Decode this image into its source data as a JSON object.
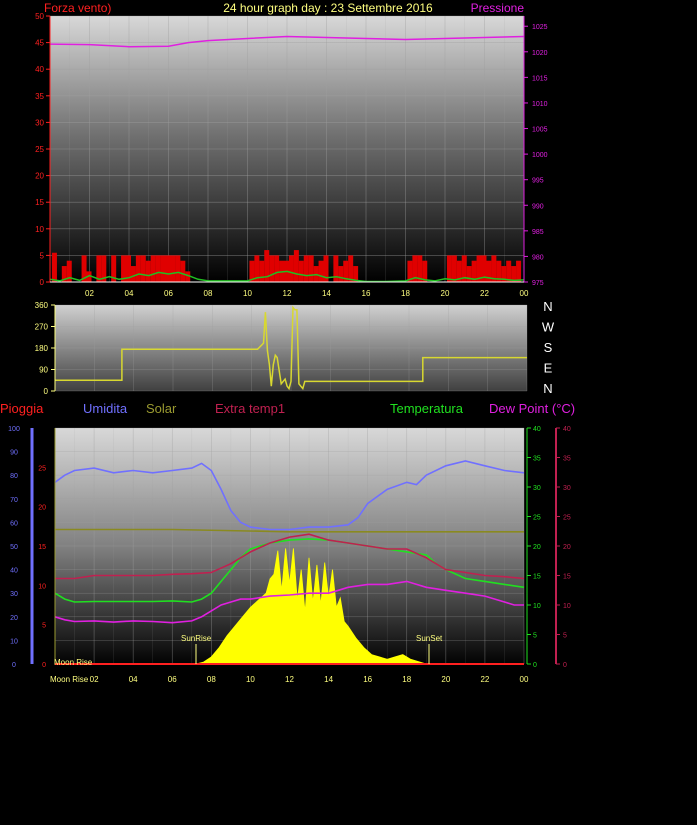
{
  "header": {
    "title": "24 hour graph day : 23 Settembre 2016",
    "left_label": "Forza vento)",
    "right_label": "Pressione"
  },
  "wind_dir_side_labels": [
    "N",
    "W",
    "S",
    "E",
    "N"
  ],
  "legend3": {
    "pioggia": "Pioggia",
    "umidita": "Umidita",
    "solar": "Solar",
    "extra_temp": "Extra temp1",
    "temperatura": "Temperatura",
    "dew_point": "Dew Point (°C)"
  },
  "event_labels": {
    "moon_rise": "Moon Rise",
    "moon_rise_axis": "Moon Rise",
    "sun_rise": "SunRise",
    "sun_set": "SunSet"
  },
  "colors": {
    "wind_axis": "#ff2020",
    "pressure": "#e020e0",
    "wind_bar": "#e00000",
    "gust": "#20c020",
    "direction": "#d8d830",
    "pioggia": "#ff2020",
    "umidita": "#7070ff",
    "solar": "#ffff00",
    "temperatura": "#20e020",
    "dew_point": "#e020e0",
    "extra_temp": "#c02050",
    "title": "#ffff80",
    "time_tick": "#ffff80"
  },
  "chart_data": [
    {
      "id": "wind_pressure",
      "type": "line",
      "title": "24 hour graph day : 23 Settembre 2016",
      "x_ticks": [
        "02",
        "04",
        "06",
        "08",
        "10",
        "12",
        "14",
        "16",
        "18",
        "20",
        "22",
        "00"
      ],
      "xlim": [
        0,
        24
      ],
      "y_left": {
        "label": "Forza vento)",
        "ylim": [
          0,
          50
        ],
        "ticks": [
          0,
          5,
          10,
          15,
          20,
          25,
          30,
          35,
          40,
          45,
          50
        ]
      },
      "y_right": {
        "label": "Pressione",
        "ylim": [
          975,
          1027
        ],
        "ticks": [
          975,
          980,
          985,
          990,
          995,
          1000,
          1005,
          1010,
          1015,
          1020,
          1025
        ]
      },
      "grid": true,
      "series": [
        {
          "name": "Pressione",
          "axis": "right",
          "x": [
            0,
            2,
            4,
            6,
            7,
            8,
            10,
            12,
            14,
            16,
            18,
            20,
            22,
            24
          ],
          "y": [
            1021.5,
            1021.4,
            1021,
            1021.1,
            1021.8,
            1022.2,
            1022.6,
            1023,
            1022.8,
            1022.6,
            1022.4,
            1022.6,
            1022.8,
            1023
          ]
        }
      ],
      "wind_bars": {
        "x": [
          0.25,
          0.5,
          0.75,
          1,
          1.25,
          1.5,
          1.75,
          2,
          2.25,
          2.5,
          2.75,
          3,
          3.25,
          3.5,
          3.75,
          4,
          4.25,
          4.5,
          4.75,
          5,
          5.25,
          5.5,
          5.75,
          6,
          6.25,
          6.5,
          6.75,
          7,
          7.25,
          7.5,
          7.75,
          8,
          8.25,
          8.5,
          8.75,
          9,
          9.25,
          9.5,
          9.75,
          10,
          10.25,
          10.5,
          10.75,
          11,
          11.25,
          11.5,
          11.75,
          12,
          12.25,
          12.5,
          12.75,
          13,
          13.25,
          13.5,
          13.75,
          14,
          14.25,
          14.5,
          14.75,
          15,
          15.25,
          15.5,
          15.75,
          16,
          16.25,
          16.5,
          16.75,
          17,
          17.25,
          17.5,
          17.75,
          18,
          18.25,
          18.5,
          18.75,
          19,
          19.25,
          19.5,
          19.75,
          20,
          20.25,
          20.5,
          20.75,
          21,
          21.25,
          21.5,
          21.75,
          22,
          22.25,
          22.5,
          22.75,
          23,
          23.25,
          23.5,
          23.75
        ],
        "y": [
          5.5,
          0,
          3,
          4,
          0,
          0,
          5,
          2,
          0,
          5,
          5,
          0,
          5,
          0,
          5,
          5,
          3,
          5,
          5,
          4,
          5,
          5,
          5,
          5,
          5,
          5,
          4,
          2,
          0,
          0,
          0,
          0,
          0,
          0,
          0,
          0,
          0,
          0,
          0,
          0,
          4,
          5,
          4,
          6,
          5,
          5,
          4,
          4,
          5,
          6,
          4,
          5,
          5,
          3,
          4,
          5,
          0,
          5,
          3,
          4,
          5,
          3,
          0,
          0,
          0,
          0,
          0,
          0,
          0,
          0,
          0,
          0,
          4,
          5,
          5,
          4,
          0,
          0,
          0,
          0,
          5,
          5,
          4,
          5,
          3,
          4,
          5,
          5,
          4,
          5,
          4,
          3,
          4,
          3,
          4
        ]
      },
      "gust_series": {
        "x": [
          0,
          0.5,
          1,
          1.5,
          2,
          2.5,
          3,
          3.5,
          4,
          4.5,
          5,
          5.5,
          6,
          6.5,
          7,
          7.5,
          8,
          9,
          10,
          10.5,
          11,
          11.5,
          12,
          12.5,
          13,
          13.5,
          14,
          14.5,
          15,
          15.5,
          16,
          17,
          18,
          18.5,
          19,
          19.5,
          20,
          20.5,
          21,
          21.5,
          22,
          22.5,
          23,
          23.5,
          24
        ],
        "y": [
          0.5,
          0.2,
          0.8,
          0.3,
          1.2,
          0.5,
          1,
          0.5,
          0.8,
          1.5,
          1.2,
          1.8,
          1.5,
          1.8,
          1.2,
          0.5,
          0.2,
          0.2,
          0.2,
          0.8,
          1,
          1.8,
          2,
          1.5,
          1.2,
          1.4,
          0.8,
          1,
          0.6,
          0.3,
          0.1,
          0.1,
          0.2,
          0.8,
          0.4,
          0.2,
          0.6,
          0.4,
          0.8,
          0.5,
          0.9,
          0.6,
          0.5,
          0.3,
          0.4
        ]
      }
    },
    {
      "id": "wind_direction",
      "type": "line",
      "ylim": [
        0,
        360
      ],
      "y_ticks": [
        0,
        90,
        180,
        270,
        360
      ],
      "xlim": [
        0,
        24
      ],
      "grid": true,
      "series": [
        {
          "name": "direction",
          "x": [
            0,
            3.4,
            3.4,
            10.3,
            10.6,
            10.7,
            10.8,
            10.9,
            11,
            11.1,
            11.2,
            11.3,
            11.5,
            11.7,
            11.8,
            11.9,
            12,
            12.1,
            12.2,
            12.3,
            12.4,
            12.5,
            12.6,
            12.7,
            12.9,
            18.7,
            18.7,
            24
          ],
          "y": [
            45,
            45,
            175,
            175,
            200,
            330,
            170,
            110,
            20,
            110,
            150,
            140,
            30,
            50,
            20,
            10,
            40,
            350,
            340,
            340,
            30,
            20,
            10,
            40,
            40,
            40,
            140,
            140
          ]
        }
      ]
    },
    {
      "id": "weather_multi",
      "type": "line",
      "x_ticks": [
        "02",
        "04",
        "06",
        "08",
        "10",
        "12",
        "14",
        "16",
        "18",
        "20",
        "22",
        "00"
      ],
      "xlim": [
        0,
        24
      ],
      "grid": true,
      "axes": {
        "pioggia": {
          "ticks": [
            0,
            5,
            10,
            15,
            20,
            25
          ]
        },
        "umidita": {
          "ticks": [
            0,
            10,
            20,
            30,
            40,
            50,
            60,
            70,
            80,
            90,
            100
          ]
        },
        "temperatura": {
          "ticks": [
            0,
            5,
            10,
            15,
            20,
            25,
            30,
            35,
            40
          ]
        },
        "dew_point": {
          "ticks": [
            0,
            5,
            10,
            15,
            20,
            25,
            30,
            35,
            40
          ]
        }
      },
      "series": [
        {
          "name": "Umidita",
          "axis": "umidita",
          "x": [
            0,
            0.5,
            1,
            2,
            3,
            4,
            5,
            6,
            7,
            7.5,
            8,
            8.5,
            9,
            9.5,
            10,
            11,
            12,
            13,
            14,
            15,
            15.5,
            16,
            17,
            18,
            18.5,
            19,
            20,
            21,
            22,
            23,
            24
          ],
          "y": [
            77,
            80,
            82,
            83,
            81,
            82,
            81,
            82,
            83,
            85,
            82,
            74,
            65,
            60,
            58,
            57,
            57,
            58,
            58,
            59,
            62,
            68,
            74,
            77,
            76,
            80,
            84,
            86,
            84,
            82,
            81
          ]
        },
        {
          "name": "Temperatura",
          "axis": "temperatura",
          "x": [
            0,
            0.5,
            1,
            2,
            3,
            4,
            5,
            6,
            7,
            7.5,
            8,
            8.5,
            9,
            9.5,
            10,
            11,
            12,
            13,
            14,
            15,
            16,
            17,
            18,
            19,
            19.5,
            20,
            21,
            22,
            23,
            24
          ],
          "y": [
            12,
            11,
            10.5,
            10.6,
            10.6,
            10.6,
            10.6,
            10.7,
            10.5,
            11,
            12,
            14,
            16,
            18,
            19.5,
            20.5,
            21,
            21.2,
            21,
            20.5,
            20,
            19.5,
            19,
            18.5,
            17,
            16,
            14.5,
            14,
            13.5,
            13
          ]
        },
        {
          "name": "Dew Point (°C)",
          "axis": "dew_point",
          "x": [
            0,
            0.5,
            1,
            2,
            3,
            4,
            5,
            6,
            7,
            7.5,
            8,
            8.5,
            9,
            9.5,
            10,
            11,
            12,
            13,
            14,
            14.5,
            15,
            16,
            17,
            18,
            19,
            20,
            21,
            22,
            23,
            23.5,
            24
          ],
          "y": [
            8,
            7.5,
            7.2,
            7.3,
            7.1,
            7.3,
            7.2,
            7.0,
            7.3,
            8,
            9,
            10,
            10.5,
            11,
            11,
            11.5,
            11.7,
            12,
            12,
            12.5,
            13,
            13.5,
            13.5,
            14,
            13,
            12.5,
            12,
            11.5,
            10.5,
            10,
            10
          ]
        },
        {
          "name": "Extra temp1",
          "axis": "temperatura",
          "x": [
            0,
            1,
            2,
            3,
            4,
            5,
            6,
            7,
            8,
            9,
            10,
            11,
            12,
            13,
            14,
            15,
            16,
            17,
            18,
            19,
            20,
            21,
            22,
            23,
            24
          ],
          "y": [
            14.5,
            14.5,
            15,
            15,
            15,
            15,
            15.2,
            15.3,
            15.5,
            17,
            19,
            20.5,
            21.5,
            22,
            21,
            20.5,
            20,
            19.5,
            19.5,
            18,
            16,
            15.5,
            15,
            14.8,
            14.5
          ]
        },
        {
          "name": "Solar",
          "axis": "umidita",
          "x": [
            0,
            6,
            12,
            18,
            24
          ],
          "y": [
            57,
            57,
            56,
            56,
            56
          ]
        }
      ],
      "solar_area": {
        "x": [
          0,
          7.2,
          7.6,
          8,
          8.4,
          8.8,
          9.2,
          9.6,
          10,
          10.4,
          10.8,
          11,
          11.2,
          11.4,
          11.6,
          11.8,
          12,
          12.2,
          12.4,
          12.6,
          12.8,
          13,
          13.2,
          13.4,
          13.6,
          13.8,
          14,
          14.2,
          14.4,
          14.6,
          14.8,
          15,
          15.4,
          15.8,
          16.2,
          16.6,
          17,
          17.4,
          17.8,
          18.2,
          18.6,
          19,
          24
        ],
        "y": [
          0,
          0,
          0.8,
          3,
          7,
          12,
          16,
          20,
          24,
          27,
          30,
          36,
          38,
          48,
          31,
          49,
          34,
          49,
          27,
          40,
          22,
          45,
          26,
          42,
          25,
          43,
          28,
          40,
          24,
          28,
          18,
          16,
          11,
          7,
          4,
          3,
          2,
          3,
          4,
          2,
          1,
          0,
          0
        ]
      }
    }
  ]
}
